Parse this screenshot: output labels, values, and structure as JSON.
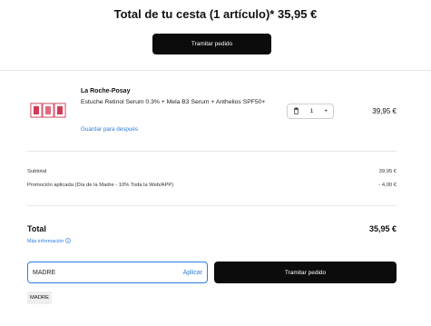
{
  "header": {
    "title": "Total de tu cesta (1 artículo)* 35,95 €",
    "checkout_label": "Tramitar pedido"
  },
  "cart_item": {
    "brand": "La Roche-Posay",
    "name": "Estuche Retinol Serum 0.3% + Mela B3 Serum + Anthelios SPF50+",
    "save_for_later": "Guardar para después",
    "quantity": "1",
    "price": "39,95 €",
    "delete_icon": "trash-icon",
    "increment_icon": "plus-icon"
  },
  "summary": {
    "subtotal_label": "Subtotal",
    "subtotal_value": "39,95 €",
    "promo_label": "Promoción aplicada (Día de la Madre - 10% Toda la Web/APP)",
    "promo_value": "- 4,00 €",
    "total_label": "Total",
    "total_value": "35,95 €",
    "more_info": "Más información",
    "more_info_icon": "info-circle-icon"
  },
  "promo": {
    "input_value": "MADRE",
    "apply_label": "Aplicar",
    "checkout_label": "Tramitar pedido",
    "applied_code": "MADRE"
  },
  "colors": {
    "primary_button": "#0c0c0c",
    "link": "#2a7de1",
    "divider": "#e7e7e7"
  }
}
